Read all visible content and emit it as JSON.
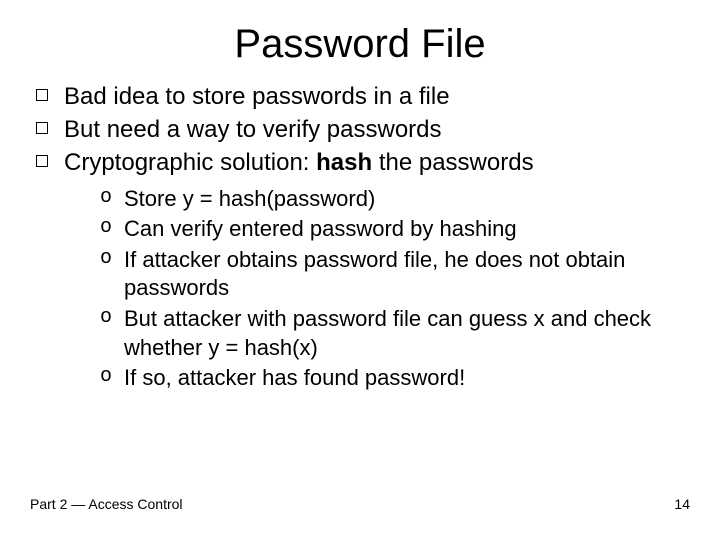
{
  "title": "Password File",
  "main": {
    "items": [
      {
        "text": "Bad idea to store passwords in a file"
      },
      {
        "text": "But need a way to verify passwords"
      },
      {
        "prefix": "Cryptographic solution: ",
        "boldword": "hash",
        "suffix": " the passwords"
      }
    ]
  },
  "sub": {
    "items": [
      {
        "text": "Store y = hash(password)"
      },
      {
        "text": "Can verify entered password by hashing"
      },
      {
        "text": "If attacker obtains password file, he does not obtain passwords"
      },
      {
        "text": "But attacker with password file can guess x and check whether y = hash(x)"
      },
      {
        "text": "If so, attacker has found password!"
      }
    ]
  },
  "footer": {
    "left_prefix": "Part 2 ",
    "left_suffix": " Access Control",
    "separator_glyph": "—",
    "page_number": "14"
  },
  "bullets": {
    "sub_glyph": "o"
  }
}
